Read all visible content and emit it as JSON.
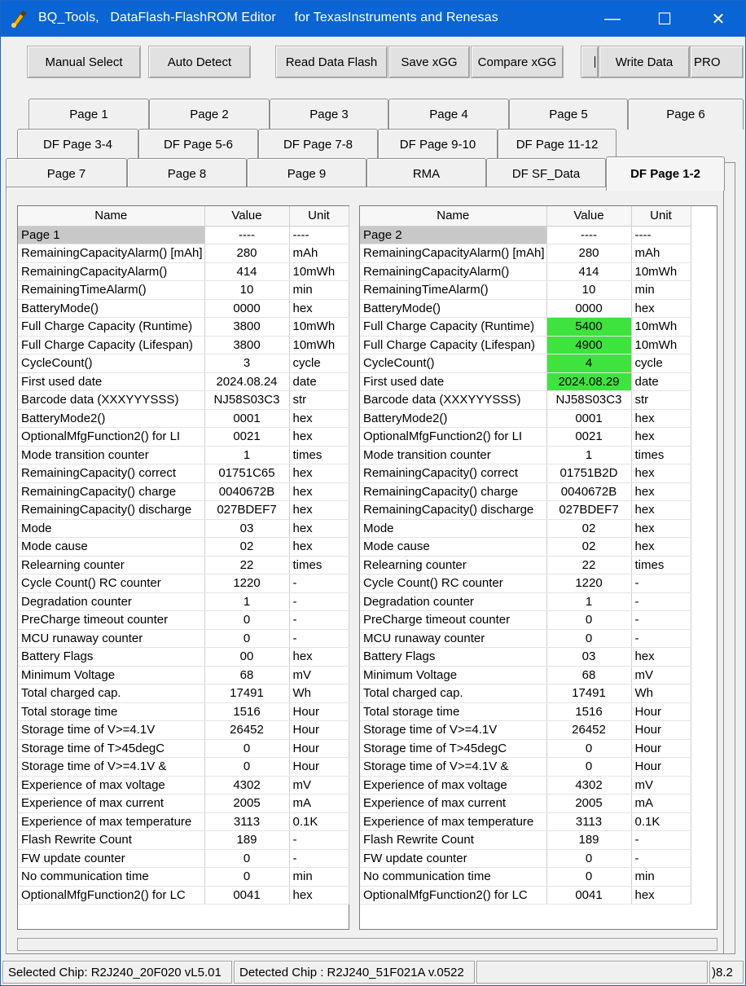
{
  "window": {
    "title": "BQ_Tools,   DataFlash-FlashROM Editor     for TexasInstruments and Renesas",
    "minimize": "—",
    "maximize": "☐",
    "close": "✕"
  },
  "toolbar": {
    "manual_select": "Manual Select",
    "auto_detect": "Auto Detect",
    "read_data_flash": "Read Data Flash",
    "save_xgg": "Save xGG",
    "compare_xgg": "Compare xGG",
    "write_data": "Write Data",
    "pro": "PRO"
  },
  "tabs": {
    "row1": [
      "Page 1",
      "Page 2",
      "Page 3",
      "Page 4",
      "Page 5",
      "Page 6"
    ],
    "row2": [
      "DF Page 3-4",
      "DF Page 5-6",
      "DF Page 7-8",
      "DF Page 9-10",
      "DF Page 11-12"
    ],
    "row3": [
      "Page 7",
      "Page 8",
      "Page 9",
      "RMA",
      "DF SF_Data",
      "DF Page 1-2"
    ],
    "active": "DF Page 1-2"
  },
  "table_headers": {
    "name": "Name",
    "value": "Value",
    "unit": "Unit"
  },
  "left_table": [
    [
      "Page 1",
      "----",
      "----"
    ],
    [
      "RemainingCapacityAlarm() [mAh]",
      "280",
      "mAh"
    ],
    [
      "RemainingCapacityAlarm()",
      "414",
      "10mWh"
    ],
    [
      "RemainingTimeAlarm()",
      "10",
      "min"
    ],
    [
      "BatteryMode()",
      "0000",
      "hex"
    ],
    [
      "Full Charge Capacity (Runtime)",
      "3800",
      "10mWh"
    ],
    [
      "Full Charge Capacity (Lifespan)",
      "3800",
      "10mWh"
    ],
    [
      "CycleCount()",
      "3",
      "cycle"
    ],
    [
      "First used date",
      "2024.08.24",
      "date"
    ],
    [
      "Barcode data (XXXYYYSSS)",
      "NJ58S03C3",
      "str"
    ],
    [
      "BatteryMode2()",
      "0001",
      "hex"
    ],
    [
      "OptionalMfgFunction2() for LI",
      "0021",
      "hex"
    ],
    [
      "Mode transition counter",
      "1",
      "times"
    ],
    [
      "RemainingCapacity() correct",
      "01751C65",
      "hex"
    ],
    [
      "RemainingCapacity() charge",
      "0040672B",
      "hex"
    ],
    [
      "RemainingCapacity() discharge",
      "027BDEF7",
      "hex"
    ],
    [
      "Mode",
      "03",
      "hex"
    ],
    [
      "Mode cause",
      "02",
      "hex"
    ],
    [
      "Relearning counter",
      "22",
      "times"
    ],
    [
      "Cycle Count() RC counter",
      "1220",
      "-"
    ],
    [
      "Degradation counter",
      "1",
      "-"
    ],
    [
      "PreCharge timeout counter",
      "0",
      "-"
    ],
    [
      "MCU runaway counter",
      "0",
      "-"
    ],
    [
      "Battery Flags",
      "00",
      "hex"
    ],
    [
      "Minimum Voltage",
      "68",
      "mV"
    ],
    [
      "Total charged cap.",
      "17491",
      "Wh"
    ],
    [
      "Total storage time",
      "1516",
      "Hour"
    ],
    [
      "Storage time of V>=4.1V",
      "26452",
      "Hour"
    ],
    [
      "Storage time of T>45degC",
      "0",
      "Hour"
    ],
    [
      "Storage time of V>=4.1V &",
      "0",
      "Hour"
    ],
    [
      "Experience of max voltage",
      "4302",
      "mV"
    ],
    [
      "Experience of max current",
      "2005",
      "mA"
    ],
    [
      "Experience of max temperature",
      "3113",
      "0.1K"
    ],
    [
      "Flash Rewrite Count",
      "189",
      "-"
    ],
    [
      "FW update counter",
      "0",
      "-"
    ],
    [
      "No communication time",
      "0",
      "min"
    ],
    [
      "OptionalMfgFunction2() for LC",
      "0041",
      "hex"
    ]
  ],
  "right_table": [
    [
      "Page 2",
      "----",
      "----"
    ],
    [
      "RemainingCapacityAlarm() [mAh]",
      "280",
      "mAh"
    ],
    [
      "RemainingCapacityAlarm()",
      "414",
      "10mWh"
    ],
    [
      "RemainingTimeAlarm()",
      "10",
      "min"
    ],
    [
      "BatteryMode()",
      "0000",
      "hex"
    ],
    [
      "Full Charge Capacity (Runtime)",
      "5400",
      "10mWh"
    ],
    [
      "Full Charge Capacity (Lifespan)",
      "4900",
      "10mWh"
    ],
    [
      "CycleCount()",
      "4",
      "cycle"
    ],
    [
      "First used date",
      "2024.08.29",
      "date"
    ],
    [
      "Barcode data (XXXYYYSSS)",
      "NJ58S03C3",
      "str"
    ],
    [
      "BatteryMode2()",
      "0001",
      "hex"
    ],
    [
      "OptionalMfgFunction2() for LI",
      "0021",
      "hex"
    ],
    [
      "Mode transition counter",
      "1",
      "times"
    ],
    [
      "RemainingCapacity() correct",
      "01751B2D",
      "hex"
    ],
    [
      "RemainingCapacity() charge",
      "0040672B",
      "hex"
    ],
    [
      "RemainingCapacity() discharge",
      "027BDEF7",
      "hex"
    ],
    [
      "Mode",
      "02",
      "hex"
    ],
    [
      "Mode cause",
      "02",
      "hex"
    ],
    [
      "Relearning counter",
      "22",
      "times"
    ],
    [
      "Cycle Count() RC counter",
      "1220",
      "-"
    ],
    [
      "Degradation counter",
      "1",
      "-"
    ],
    [
      "PreCharge timeout counter",
      "0",
      "-"
    ],
    [
      "MCU runaway counter",
      "0",
      "-"
    ],
    [
      "Battery Flags",
      "03",
      "hex"
    ],
    [
      "Minimum Voltage",
      "68",
      "mV"
    ],
    [
      "Total charged cap.",
      "17491",
      "Wh"
    ],
    [
      "Total storage time",
      "1516",
      "Hour"
    ],
    [
      "Storage time of V>=4.1V",
      "26452",
      "Hour"
    ],
    [
      "Storage time of T>45degC",
      "0",
      "Hour"
    ],
    [
      "Storage time of V>=4.1V &",
      "0",
      "Hour"
    ],
    [
      "Experience of max voltage",
      "4302",
      "mV"
    ],
    [
      "Experience of max current",
      "2005",
      "mA"
    ],
    [
      "Experience of max temperature",
      "3113",
      "0.1K"
    ],
    [
      "Flash Rewrite Count",
      "189",
      "-"
    ],
    [
      "FW update counter",
      "0",
      "-"
    ],
    [
      "No communication time",
      "0",
      "min"
    ],
    [
      "OptionalMfgFunction2() for LC",
      "0041",
      "hex"
    ]
  ],
  "highlighted_rows_right": [
    5,
    6,
    7,
    8
  ],
  "highlight_color": "#3ee33e",
  "title_bar_color": "#0b64d3",
  "status": {
    "selected_chip": "Selected Chip:  R2J240_20F020 vL5.01",
    "detected_chip": "Detected Chip : R2J240_51F021A  v.0522",
    "right_fragment": ")8.2"
  }
}
